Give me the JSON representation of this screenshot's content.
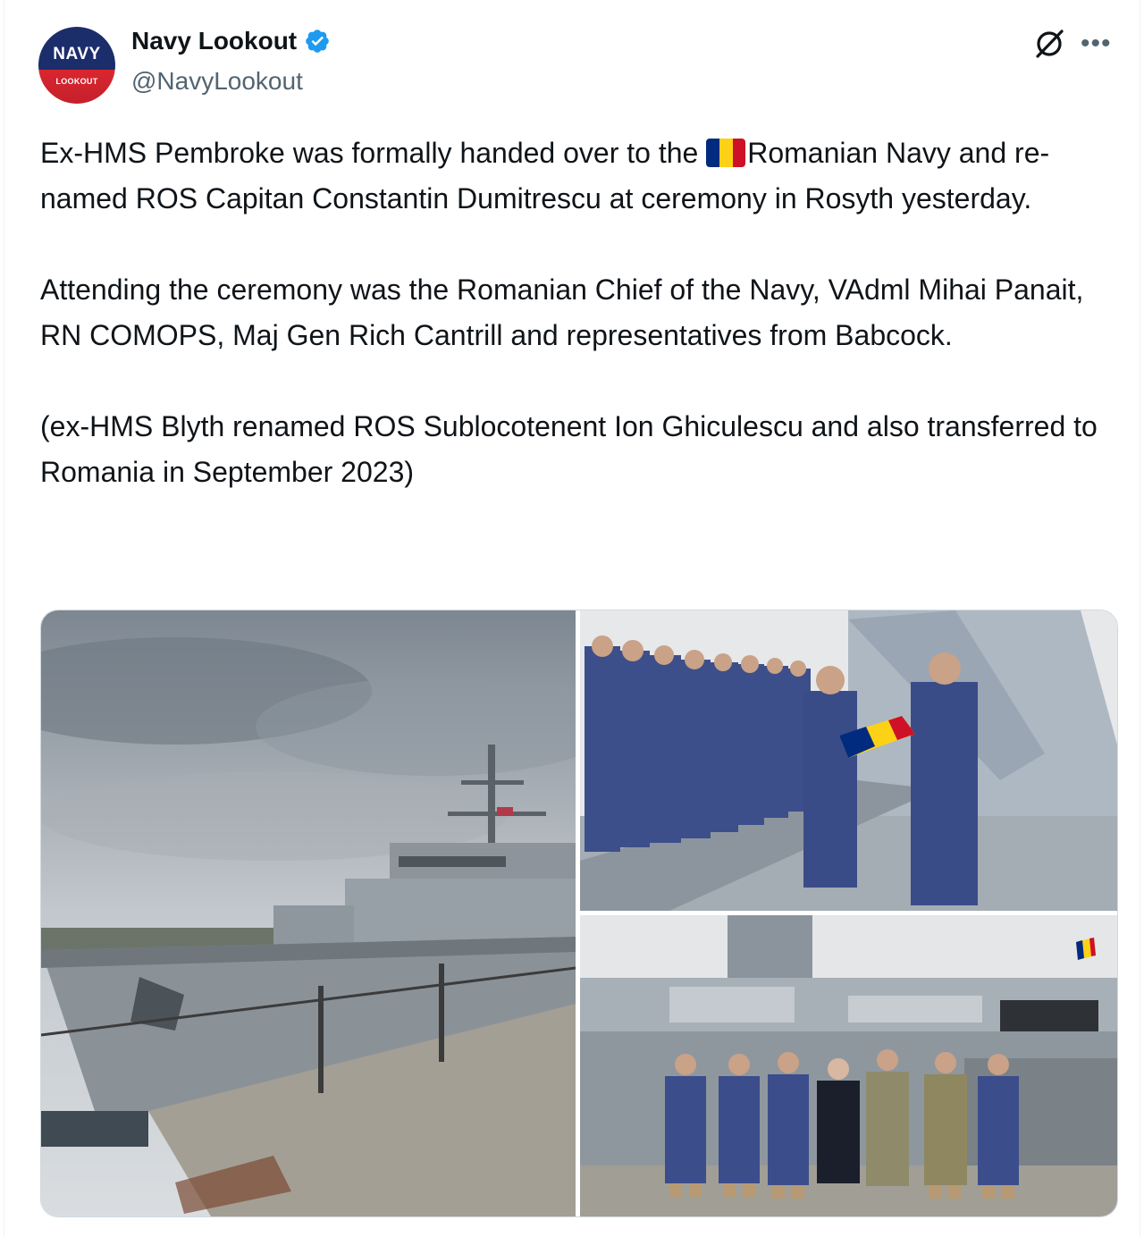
{
  "account": {
    "display_name": "Navy Lookout",
    "handle": "@NavyLookout",
    "avatar_text_top": "NAVY",
    "avatar_text_bottom": "LOOKOUT",
    "verified": true
  },
  "post": {
    "p1_before_flag": "Ex-HMS Pembroke was formally handed over to the ",
    "p1_after_flag": "Romanian Navy and re-named ROS Capitan Constantin Dumitrescu at ceremony in Rosyth yesterday.",
    "p2": "Attending the ceremony was the Romanian Chief of the Navy, VAdml Mihai Panait, RN COMOPS, Maj Gen Rich Cantrill and representatives from Babcock.",
    "p3": "(ex-HMS Blyth renamed ROS Sublocotenent Ion Ghiculescu and also transferred to Romania in September 2023)",
    "flag_emoji": "romania-flag",
    "media_count": 3
  },
  "icons": {
    "verified": "verified-badge-icon",
    "grok": "grok-icon",
    "more": "more-options-icon"
  },
  "colors": {
    "verified_blue": "#1d9bf0",
    "text_primary": "#0f1419",
    "text_secondary": "#536471",
    "flag_blue": "#002b7f",
    "flag_yellow": "#fcd116",
    "flag_red": "#ce1126"
  }
}
